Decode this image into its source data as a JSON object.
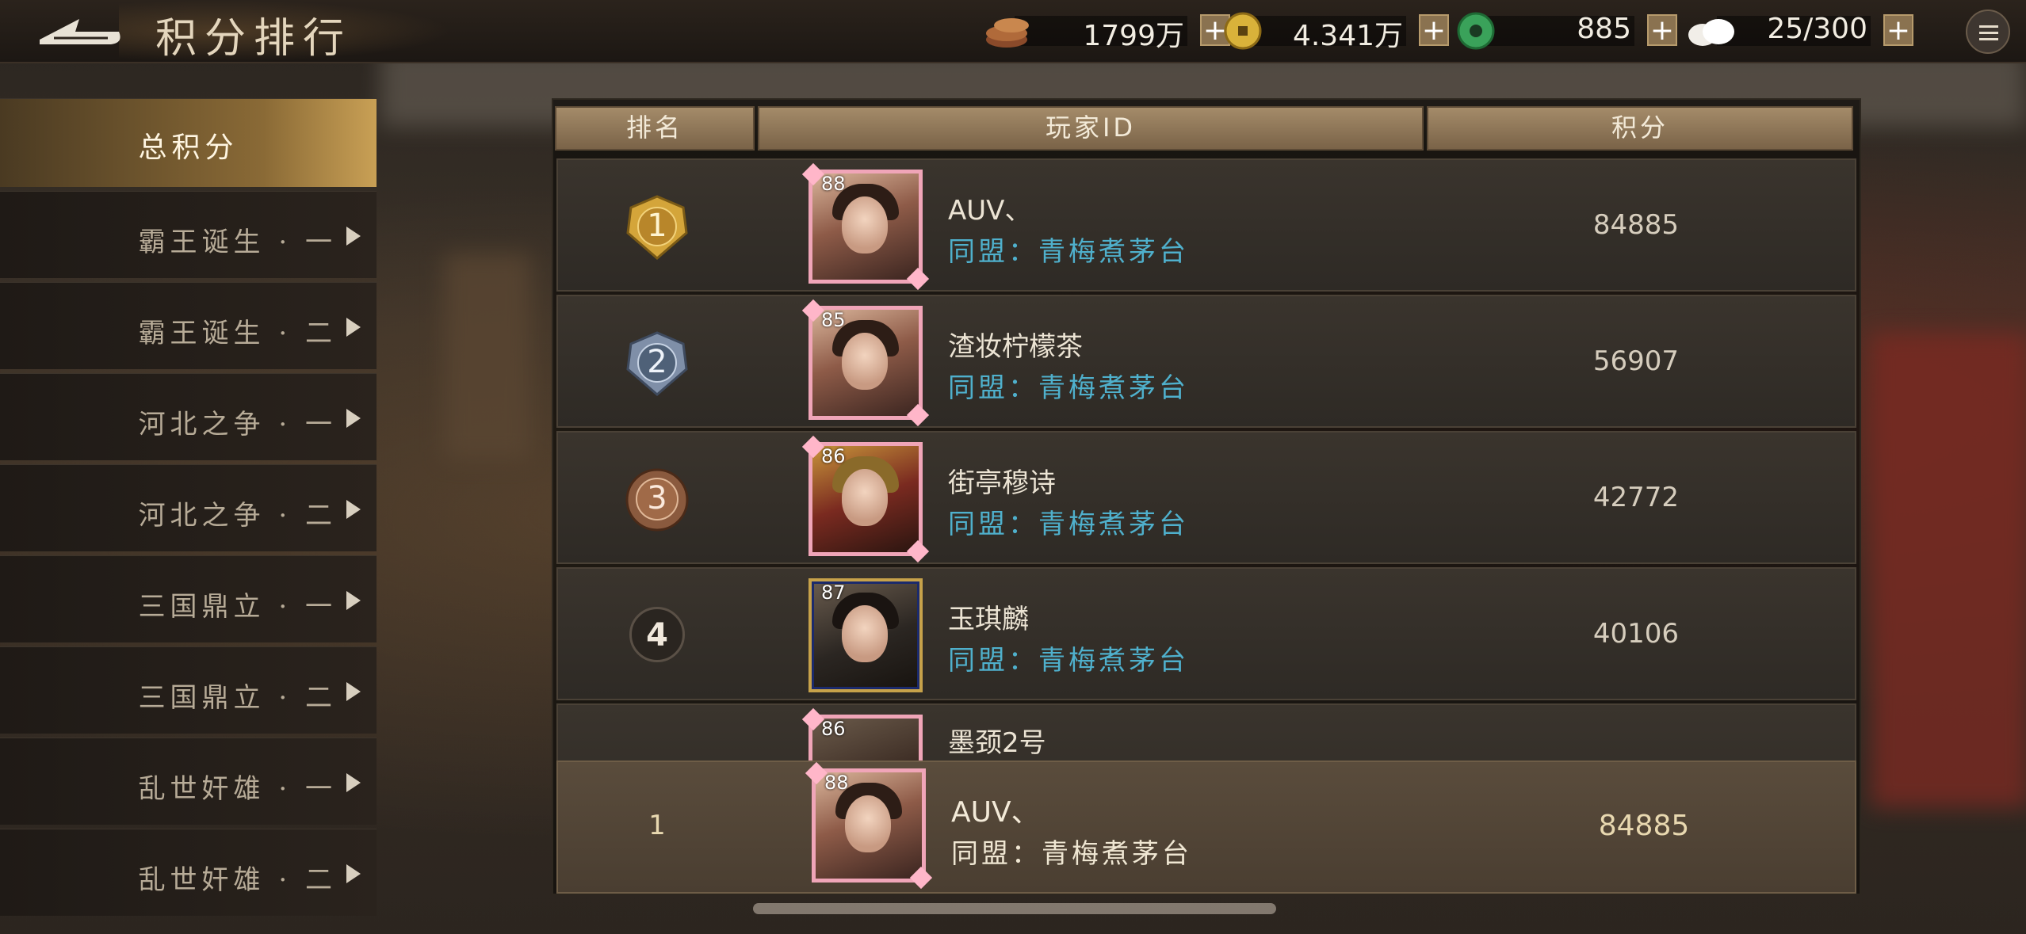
{
  "header": {
    "title": "积分排行"
  },
  "resources": [
    {
      "icon": "copper-coins-icon",
      "value": "1799万"
    },
    {
      "icon": "gold-coin-icon",
      "value": "4.341万"
    },
    {
      "icon": "jade-coin-icon",
      "value": "885"
    },
    {
      "icon": "bun-food-icon",
      "value": "25/300"
    }
  ],
  "plus_label": "+",
  "sidebar": {
    "items": [
      {
        "label": "总积分"
      },
      {
        "label": "霸王诞生 · 一"
      },
      {
        "label": "霸王诞生 · 二"
      },
      {
        "label": "河北之争 · 一"
      },
      {
        "label": "河北之争 · 二"
      },
      {
        "label": "三国鼎立 · 一"
      },
      {
        "label": "三国鼎立 · 二"
      },
      {
        "label": "乱世奸雄 · 一"
      },
      {
        "label": "乱世奸雄 · 二"
      }
    ]
  },
  "table": {
    "columns": [
      "排名",
      "玩家ID",
      "积分"
    ],
    "rows": [
      {
        "rank": "1",
        "level": "88",
        "name": "AUV、",
        "alliance": "同盟：青梅煮茅台",
        "score": "84885"
      },
      {
        "rank": "2",
        "level": "85",
        "name": "渣妆柠檬茶",
        "alliance": "同盟：青梅煮茅台",
        "score": "56907"
      },
      {
        "rank": "3",
        "level": "86",
        "name": "街亭穆诗",
        "alliance": "同盟：青梅煮茅台",
        "score": "42772"
      },
      {
        "rank": "4",
        "level": "87",
        "name": "玉琪麟",
        "alliance": "同盟：青梅煮茅台",
        "score": "40106"
      },
      {
        "rank": "",
        "level": "86",
        "name": "墨颈2号",
        "alliance": "",
        "score": ""
      }
    ]
  },
  "my_rank": {
    "rank": "1",
    "level": "88",
    "name": "AUV、",
    "alliance": "同盟：青梅煮茅台",
    "score": "84885"
  },
  "colors": {
    "alliance_text": "#4fb0cc",
    "gold_medal": "#d4a53a",
    "silver_medal": "#7f8fa8",
    "bronze_medal": "#a06a48"
  }
}
